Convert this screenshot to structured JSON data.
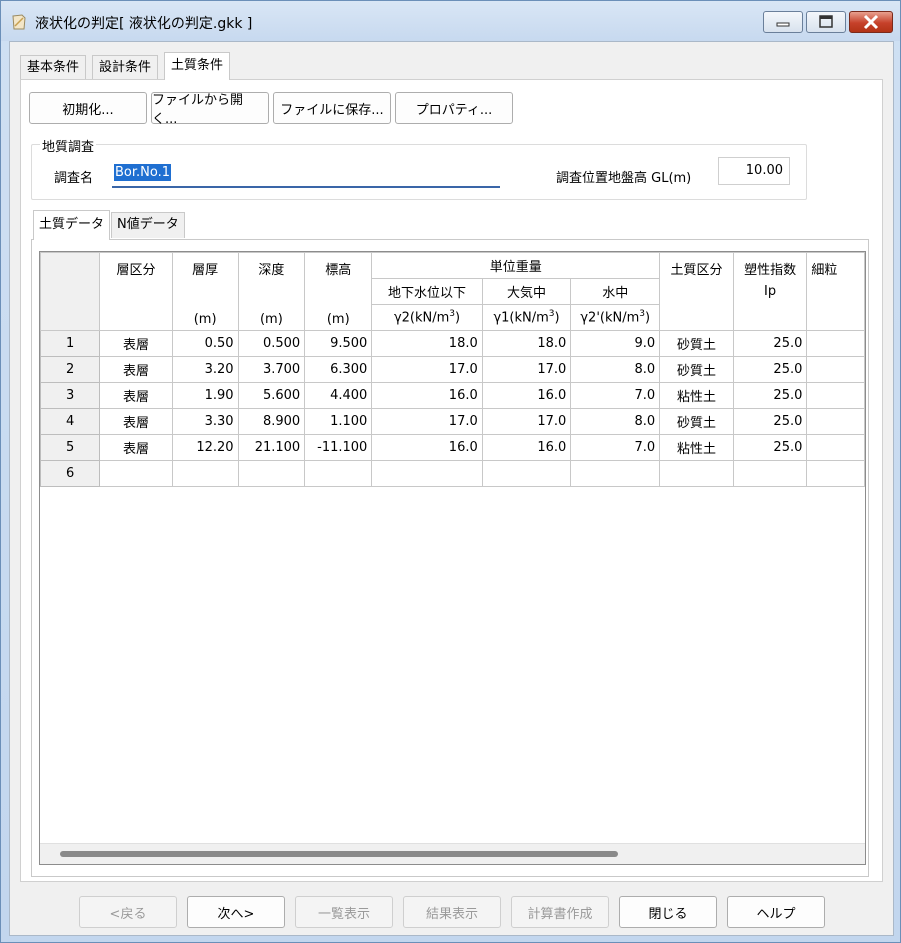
{
  "window": {
    "title": "液状化の判定[ 液状化の判定.gkk ]"
  },
  "tabs": [
    {
      "label": "基本条件"
    },
    {
      "label": "設計条件"
    },
    {
      "label": "土質条件",
      "active": true
    }
  ],
  "toolbar": {
    "init_label": "初期化...",
    "open_label": "ファイルから開く...",
    "save_label": "ファイルに保存...",
    "props_label": "プロパティ..."
  },
  "survey": {
    "group_label": "地質調査",
    "name_label": "調査名",
    "name_value": "Bor.No.1",
    "gl_label": "調査位置地盤高 GL(m)",
    "gl_value": "10.00"
  },
  "subtabs": [
    {
      "label": "土質データ",
      "active": true
    },
    {
      "label": "N値データ"
    }
  ],
  "grid": {
    "headers": {
      "layer": "層区分",
      "thickness": "層厚",
      "thickness_unit": "(m)",
      "depth": "深度",
      "depth_unit": "(m)",
      "elev": "標高",
      "elev_unit": "(m)",
      "unit_weight": "単位重量",
      "gw_below": "地下水位以下",
      "gw_below_unit": "γ2(kN/m3)",
      "air": "大気中",
      "air_unit": "γ1(kN/m3)",
      "water": "水中",
      "water_unit": "γ2'(kN/m3)",
      "soil": "土質区分",
      "pi": "塑性指数",
      "pi_unit": "Ip",
      "fine": "細粒"
    },
    "rows": [
      {
        "no": "1",
        "layer": "表層",
        "thickness": "0.50",
        "depth": "0.500",
        "elev": "9.500",
        "g2": "18.0",
        "g1": "18.0",
        "g2p": "9.0",
        "soil": "砂質土",
        "pi": "25.0"
      },
      {
        "no": "2",
        "layer": "表層",
        "thickness": "3.20",
        "depth": "3.700",
        "elev": "6.300",
        "g2": "17.0",
        "g1": "17.0",
        "g2p": "8.0",
        "soil": "砂質土",
        "pi": "25.0"
      },
      {
        "no": "3",
        "layer": "表層",
        "thickness": "1.90",
        "depth": "5.600",
        "elev": "4.400",
        "g2": "16.0",
        "g1": "16.0",
        "g2p": "7.0",
        "soil": "粘性土",
        "pi": "25.0"
      },
      {
        "no": "4",
        "layer": "表層",
        "thickness": "3.30",
        "depth": "8.900",
        "elev": "1.100",
        "g2": "17.0",
        "g1": "17.0",
        "g2p": "8.0",
        "soil": "砂質土",
        "pi": "25.0"
      },
      {
        "no": "5",
        "layer": "表層",
        "thickness": "12.20",
        "depth": "21.100",
        "elev": "-11.100",
        "g2": "16.0",
        "g1": "16.0",
        "g2p": "7.0",
        "soil": "粘性土",
        "pi": "25.0"
      },
      {
        "no": "6",
        "layer": "",
        "thickness": "",
        "depth": "",
        "elev": "",
        "g2": "",
        "g1": "",
        "g2p": "",
        "soil": "",
        "pi": ""
      }
    ]
  },
  "footer": {
    "back_label": "<戻る",
    "next_label": "次へ>",
    "list_label": "一覧表示",
    "result_label": "結果表示",
    "report_label": "計算書作成",
    "close_label": "閉じる",
    "help_label": "ヘルプ"
  }
}
